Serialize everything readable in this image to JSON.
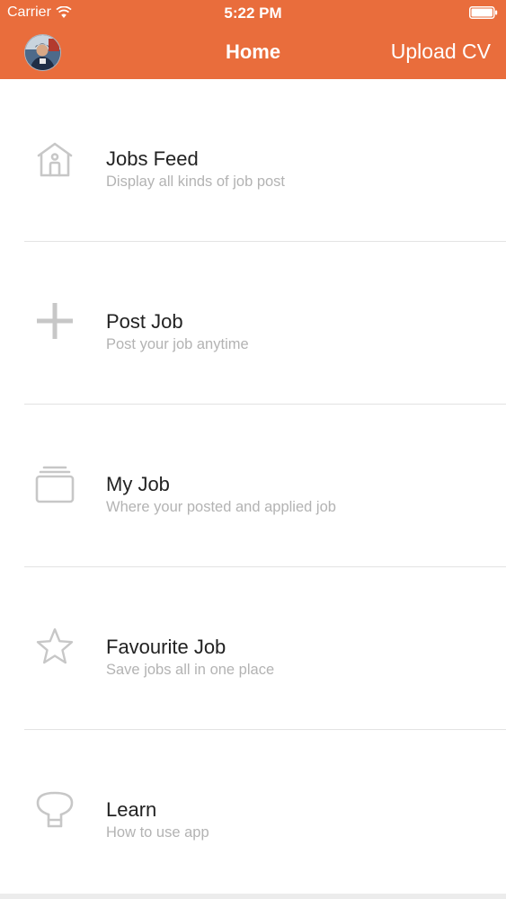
{
  "status_bar": {
    "carrier": "Carrier",
    "time": "5:22 PM",
    "wifi_icon": "wifi-icon",
    "battery_icon": "battery-icon"
  },
  "nav": {
    "title": "Home",
    "action": "Upload CV",
    "avatar_icon": "avatar"
  },
  "theme": {
    "accent": "#E96D3C",
    "title_text": "#222222",
    "subtitle_text": "#B3B3B3",
    "icon_color": "#C7C7C7"
  },
  "menu": [
    {
      "icon": "house-icon",
      "title": "Jobs Feed",
      "subtitle": "Display all kinds of job post"
    },
    {
      "icon": "plus-icon",
      "title": "Post Job",
      "subtitle": "Post your job anytime"
    },
    {
      "icon": "stack-icon",
      "title": "My Job",
      "subtitle": "Where your posted and applied job"
    },
    {
      "icon": "star-icon",
      "title": "Favourite Job",
      "subtitle": "Save jobs all in one place"
    },
    {
      "icon": "lightbulb-icon",
      "title": "Learn",
      "subtitle": "How to use app"
    }
  ]
}
